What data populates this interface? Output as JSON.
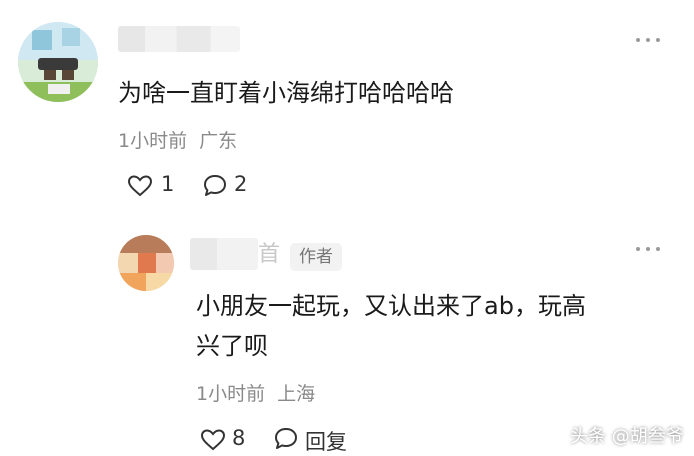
{
  "comment": {
    "text": "为啥一直盯着小海绵打哈哈哈哈",
    "time": "1小时前",
    "location": "广东",
    "likes": "1",
    "replies": "2"
  },
  "reply": {
    "name_suffix": "首",
    "badge": "作者",
    "text_line1": "小朋友一起玩，又认出来了ab，玩高",
    "text_line2": "兴了呗",
    "time": "1小时前",
    "location": "上海",
    "likes": "8",
    "reply_label": "回复"
  },
  "watermark": "头条 @胡叁爷"
}
